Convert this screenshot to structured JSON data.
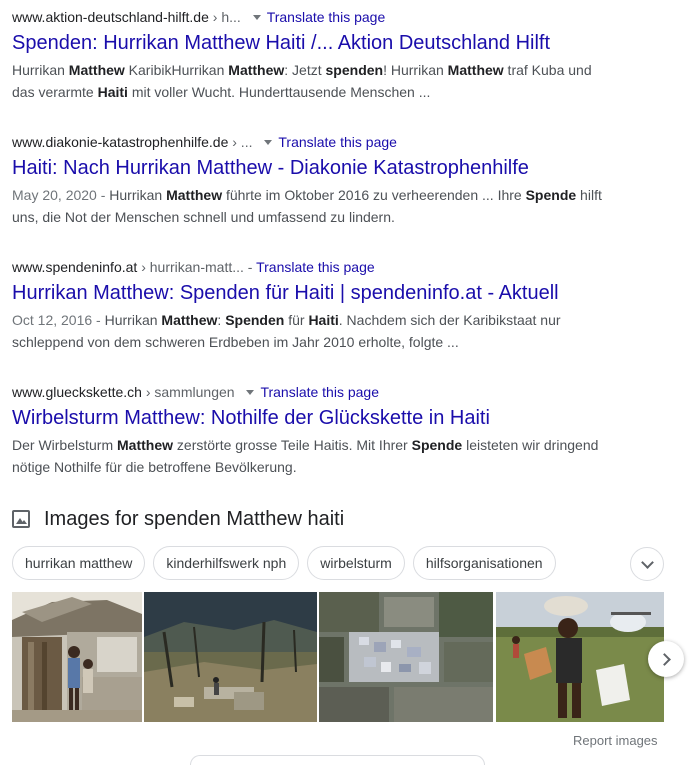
{
  "colors": {
    "link": "#1a0dab",
    "snippet": "#4d5156",
    "url": "#202124"
  },
  "results": [
    {
      "domain": "www.aktion-deutschland-hilft.de",
      "path": "› h...",
      "translate": "Translate this page",
      "title": "Spenden: Hurrikan Matthew Haiti /... Aktion Deutschland Hilft",
      "date": "",
      "snippet_html": "Hurrikan <b>Matthew</b> KaribikHurrikan <b>Matthew</b>: Jetzt <b>spenden</b>! Hurrikan <b>Matthew</b> traf Kuba und das verarmte <b>Haiti</b> mit voller Wucht. Hunderttausende Menschen ..."
    },
    {
      "domain": "www.diakonie-katastrophenhilfe.de",
      "path": "› ...",
      "translate": "Translate this page",
      "title": "Haiti: Nach Hurrikan Matthew - Diakonie Katastrophenhilfe",
      "date": "May 20, 2020 -",
      "snippet_html": "Hurrikan <b>Matthew</b> führte im Oktober 2016 zu verheerenden ... Ihre <b>Spende</b> hilft uns, die Not der Menschen schnell und umfassend zu lindern."
    },
    {
      "domain": "www.spendeninfo.at",
      "path": "› hurrikan-matt...",
      "translate": "Translate this page",
      "title": "Hurrikan Matthew: Spenden für Haiti | spendeninfo.at - Aktuell",
      "date": "Oct 12, 2016 -",
      "snippet_html": "Hurrikan <b>Matthew</b>: <b>Spenden</b> für <b>Haiti</b>. Nachdem sich der Karibikstaat nur schleppend von dem schweren Erdbeben im Jahr 2010 erholte, folgte ..."
    },
    {
      "domain": "www.glueckskette.ch",
      "path": "› sammlungen",
      "translate": "Translate this page",
      "title": "Wirbelsturm Matthew: Nothilfe der Glückskette in Haiti",
      "date": "",
      "snippet_html": "Der Wirbelsturm <b>Matthew</b> zerstörte grosse Teile Haitis. Mit Ihrer <b>Spende</b> leisteten wir dringend nötige Nothilfe für die betroffene Bevölkerung."
    }
  ],
  "images_section": {
    "title": "Images for spenden Matthew haiti",
    "icon": "image-icon",
    "chips": [
      "hurrikan matthew",
      "kinderhilfswerk nph",
      "wirbelsturm",
      "hilfsorganisationen"
    ],
    "expand_icon": "chevron-down-icon",
    "next_icon": "chevron-right-icon",
    "report_label": "Report images"
  }
}
